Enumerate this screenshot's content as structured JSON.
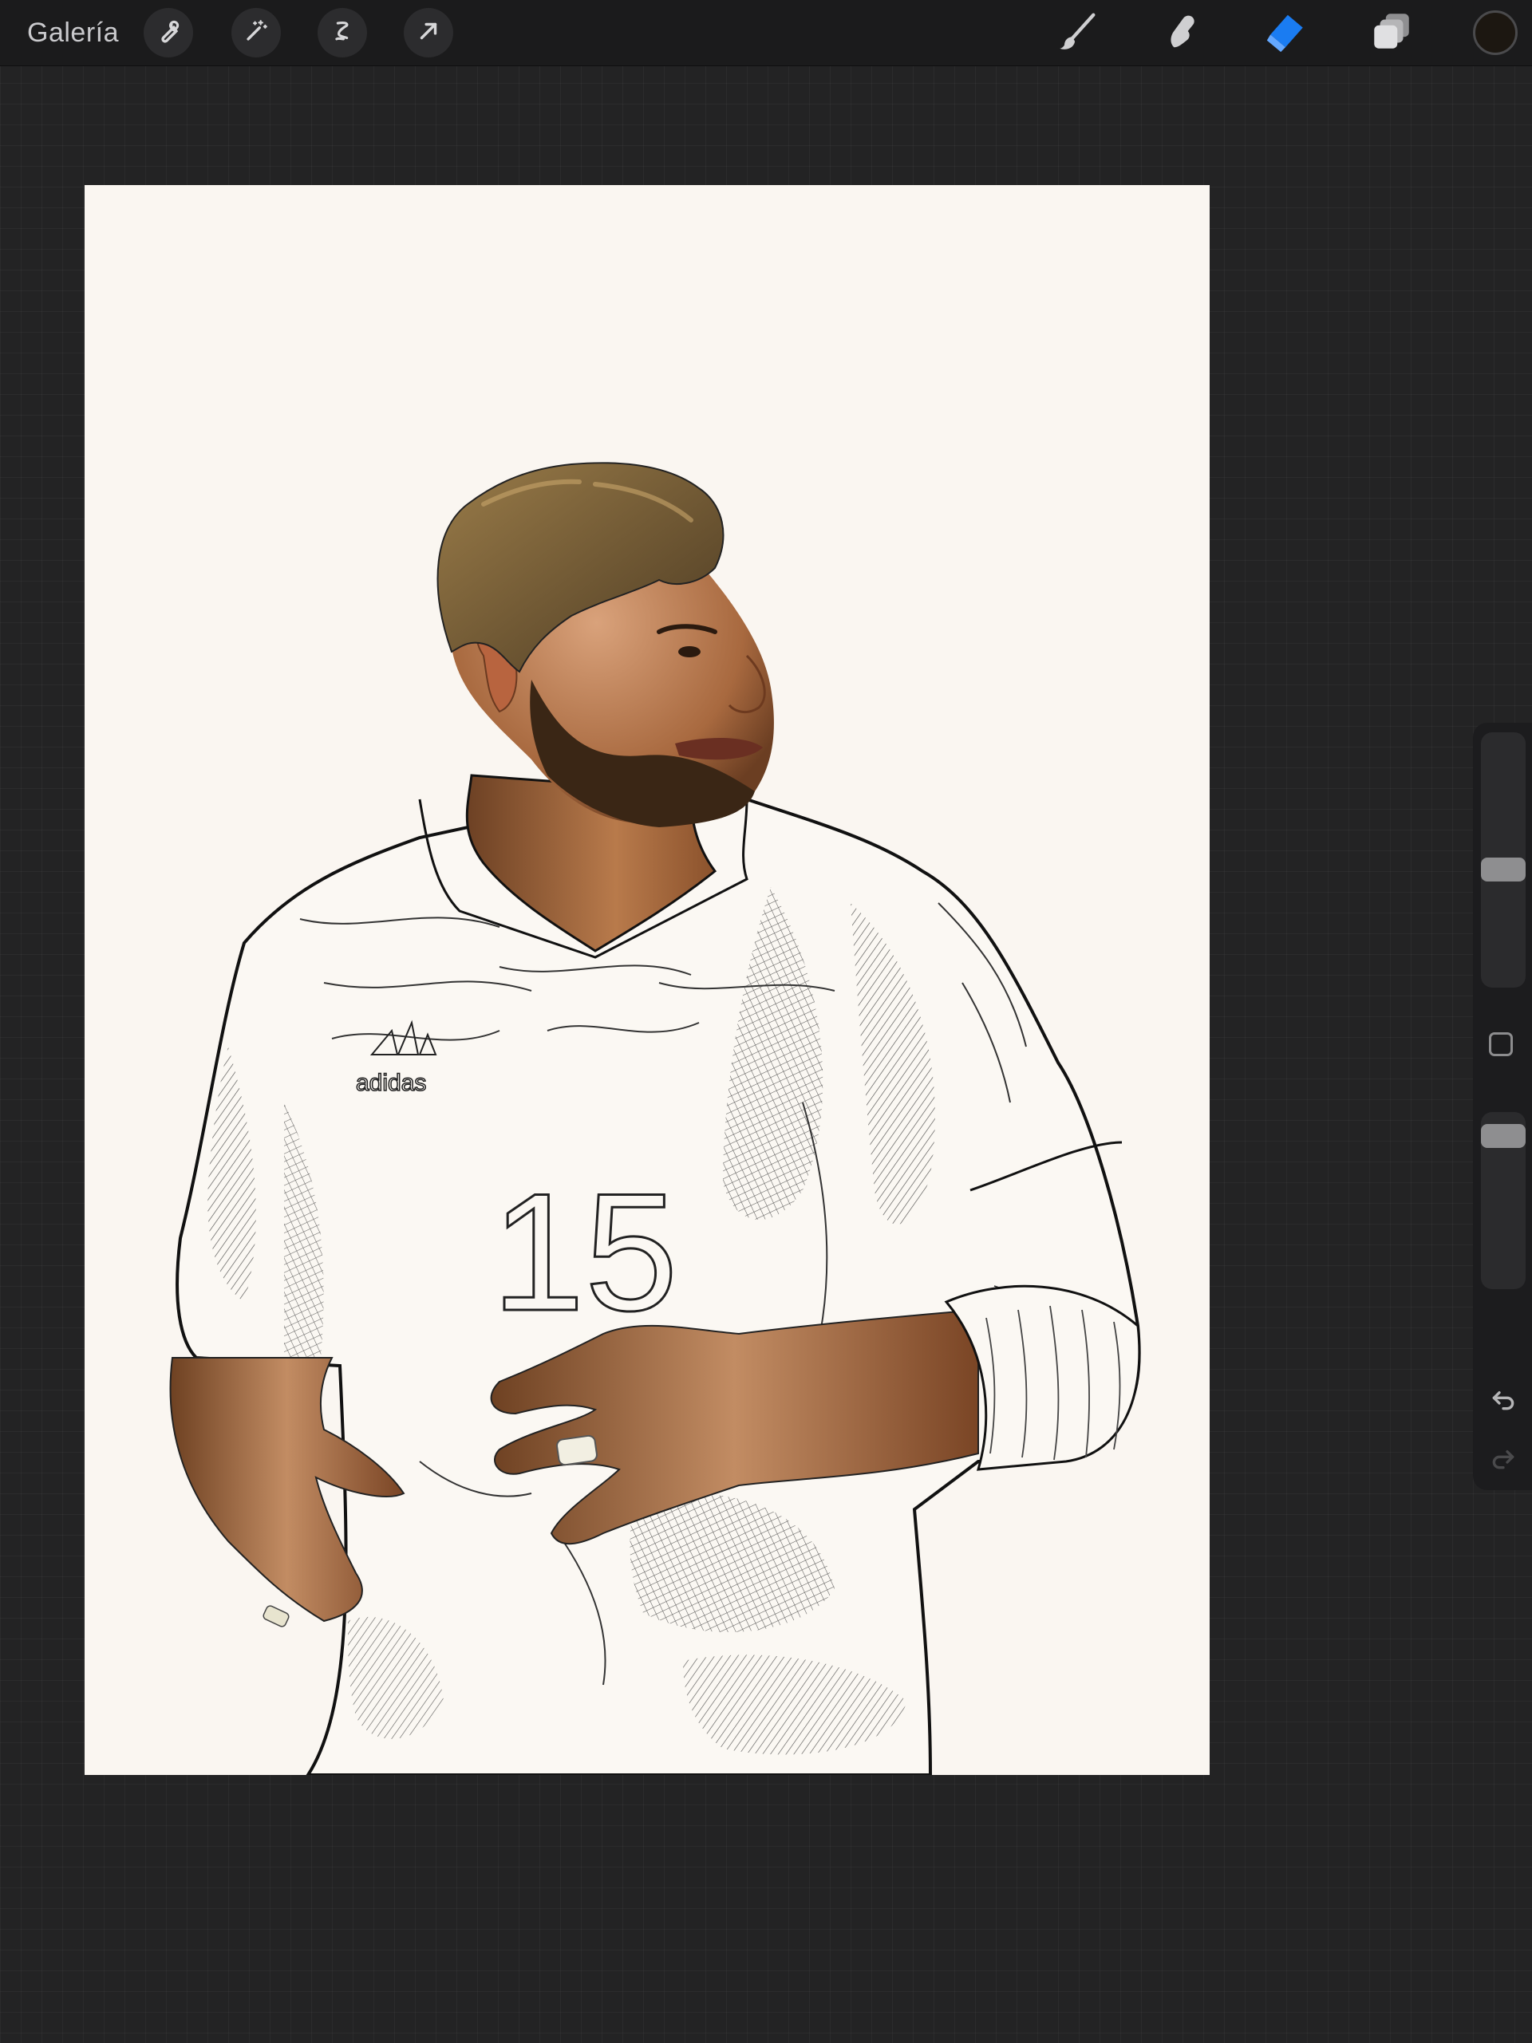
{
  "toolbar": {
    "gallery_label": "Galería",
    "left_tools": [
      "wrench-icon",
      "magic-wand-icon",
      "selection-icon",
      "transform-arrow-icon"
    ],
    "right_tools": [
      "brush-icon",
      "smudge-icon",
      "eraser-icon",
      "layers-icon"
    ],
    "active_tool": "eraser",
    "active_color": "#1c1711",
    "accent_color": "#1a7cf2"
  },
  "canvas": {
    "artwork_text": {
      "brand": "adidas",
      "number": "15"
    },
    "background_color": "#faf6f1"
  },
  "sidebar": {
    "size_level": 0.46,
    "opacity_level": 0.08,
    "icons": [
      "modify-square-icon",
      "undo-icon",
      "redo-icon"
    ]
  }
}
